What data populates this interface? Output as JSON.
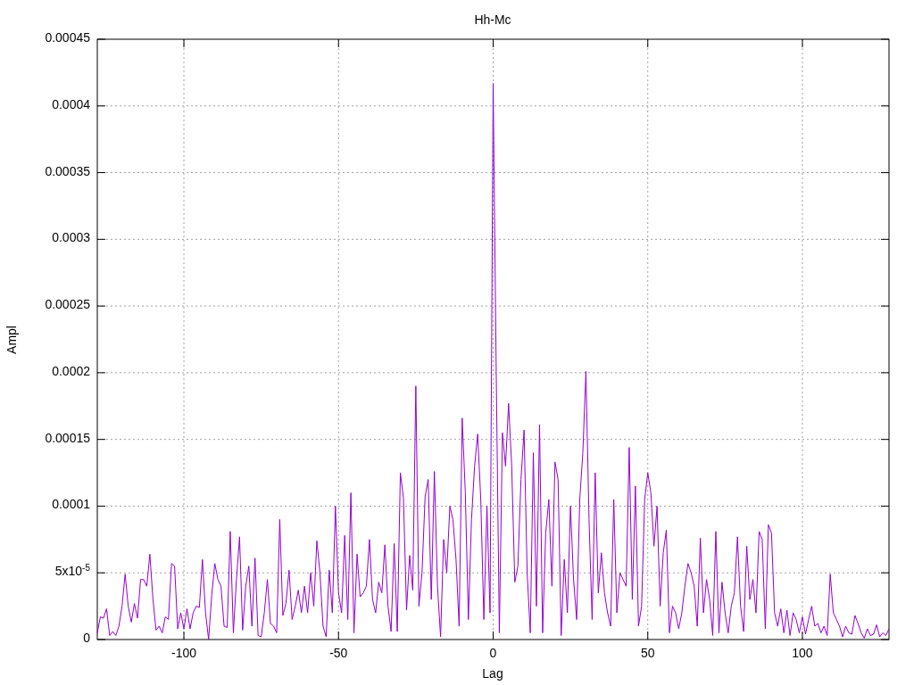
{
  "chart_data": {
    "type": "line",
    "grid": true,
    "title": "Hh-Mc",
    "xlabel": "Lag",
    "ylabel": "Ampl",
    "xlim": [
      -128,
      128
    ],
    "ylim": [
      0,
      0.00045
    ],
    "xticks": [
      -100,
      -50,
      0,
      50,
      100
    ],
    "yticks": [
      0,
      {
        "value": 5e-05,
        "label": "5x10$^{-5}$"
      },
      0.0001,
      0.00015,
      0.0002,
      0.00025,
      0.0003,
      0.00035,
      0.0004,
      0.00045
    ],
    "x": [
      -128,
      -127,
      -126,
      -125,
      -124,
      -123,
      -122,
      -121,
      -120,
      -119,
      -118,
      -117,
      -116,
      -115,
      -114,
      -113,
      -112,
      -111,
      -110,
      -109,
      -108,
      -107,
      -106,
      -105,
      -104,
      -103,
      -102,
      -101,
      -100,
      -99,
      -98,
      -97,
      -96,
      -95,
      -94,
      -93,
      -92,
      -91,
      -90,
      -89,
      -88,
      -87,
      -86,
      -85,
      -84,
      -83,
      -82,
      -81,
      -80,
      -79,
      -78,
      -77,
      -76,
      -75,
      -74,
      -73,
      -72,
      -71,
      -70,
      -69,
      -68,
      -67,
      -66,
      -65,
      -64,
      -63,
      -62,
      -61,
      -60,
      -59,
      -58,
      -57,
      -56,
      -55,
      -54,
      -53,
      -52,
      -51,
      -50,
      -49,
      -48,
      -47,
      -46,
      -45,
      -44,
      -43,
      -42,
      -41,
      -40,
      -39,
      -38,
      -37,
      -36,
      -35,
      -34,
      -33,
      -32,
      -31,
      -30,
      -29,
      -28,
      -27,
      -26,
      -25,
      -24,
      -23,
      -22,
      -21,
      -20,
      -19,
      -18,
      -17,
      -16,
      -15,
      -14,
      -13,
      -12,
      -11,
      -10,
      -9,
      -8,
      -7,
      -6,
      -5,
      -4,
      -3,
      -2,
      -1,
      0,
      1,
      2,
      3,
      4,
      5,
      6,
      7,
      8,
      9,
      10,
      11,
      12,
      13,
      14,
      15,
      16,
      17,
      18,
      19,
      20,
      21,
      22,
      23,
      24,
      25,
      26,
      27,
      28,
      29,
      30,
      31,
      32,
      33,
      34,
      35,
      36,
      37,
      38,
      39,
      40,
      41,
      42,
      43,
      44,
      45,
      46,
      47,
      48,
      49,
      50,
      51,
      52,
      53,
      54,
      55,
      56,
      57,
      58,
      59,
      60,
      61,
      62,
      63,
      64,
      65,
      66,
      67,
      68,
      69,
      70,
      71,
      72,
      73,
      74,
      75,
      76,
      77,
      78,
      79,
      80,
      81,
      82,
      83,
      84,
      85,
      86,
      87,
      88,
      89,
      90,
      91,
      92,
      93,
      94,
      95,
      96,
      97,
      98,
      99,
      100,
      101,
      102,
      103,
      104,
      105,
      106,
      107,
      108,
      109,
      110,
      111,
      112,
      113,
      114,
      115,
      116,
      117,
      118,
      119,
      120,
      121,
      122,
      123,
      124,
      125,
      126,
      127,
      128
    ],
    "series": [
      {
        "color": "#9400d3",
        "values": [
          5e-06,
          1.7e-05,
          1.6e-05,
          2.3e-05,
          3e-06,
          6e-06,
          3e-06,
          1e-05,
          2.5e-05,
          4.9e-05,
          2.5e-05,
          1.3e-05,
          2.7e-05,
          1.6e-05,
          4.5e-05,
          4.5e-05,
          4e-05,
          6.4e-05,
          3e-05,
          7e-06,
          1e-05,
          5e-06,
          1.7e-05,
          1.5e-05,
          5.7e-05,
          5.5e-05,
          8e-06,
          2e-05,
          8e-06,
          2.3e-05,
          8e-06,
          2e-05,
          2.5e-05,
          2.4e-05,
          6e-05,
          2e-05,
          0,
          3.3e-05,
          5.7e-05,
          4.5e-05,
          4e-05,
          1e-05,
          9e-06,
          8.1e-05,
          5e-06,
          4.5e-05,
          7.7e-05,
          7e-06,
          4e-05,
          5.5e-05,
          1e-05,
          6.1e-05,
          3e-06,
          2e-06,
          2e-05,
          4.5e-05,
          1.2e-05,
          1e-05,
          5e-06,
          9e-05,
          1.8e-05,
          2.7e-05,
          5.2e-05,
          1.5e-05,
          2.5e-05,
          3.7e-05,
          2e-05,
          4e-05,
          2e-05,
          5e-05,
          2.5e-05,
          7.4e-05,
          5e-05,
          1e-05,
          2e-06,
          5.2e-05,
          2e-05,
          0.0001,
          3.5e-05,
          2e-05,
          7.8e-05,
          1.5e-05,
          0.00011,
          5e-06,
          6.4e-05,
          3.2e-05,
          3.5e-05,
          4e-05,
          7.5e-05,
          3e-05,
          2e-05,
          4.3e-05,
          3.5e-05,
          7.1e-05,
          2.5e-05,
          6e-06,
          7.2e-05,
          6e-06,
          0.000125,
          0.000106,
          2.2e-05,
          6.3e-05,
          3.7e-05,
          0.00019,
          2.5e-05,
          5e-05,
          0.000107,
          0.00012,
          3e-05,
          0.000126,
          4e-05,
          2e-06,
          7.5e-05,
          5e-05,
          0.0001,
          9e-05,
          6e-05,
          1e-05,
          0.000166,
          0.00011,
          1.5e-05,
          9e-05,
          0.00013,
          0.000154,
          0.000105,
          1.5e-05,
          0.0001,
          2e-05,
          0.000417,
          0.0002,
          5e-06,
          0.000155,
          0.00013,
          0.000177,
          0.00013,
          4.3e-05,
          5.5e-05,
          0.00012,
          0.000157,
          5e-05,
          5e-06,
          0.00014,
          2.5e-05,
          0.000161,
          5e-06,
          8e-05,
          0.000105,
          4e-05,
          0.000133,
          0.00012,
          3e-06,
          6e-05,
          2e-05,
          0.0001,
          4.5e-05,
          1.5e-05,
          0.000105,
          0.00014,
          0.000201,
          9e-05,
          1.5e-05,
          0.000125,
          3.5e-05,
          6.5e-05,
          3.5e-05,
          2e-05,
          1e-05,
          0.000105,
          2e-05,
          5e-05,
          4.5e-05,
          4e-05,
          0.000144,
          3e-05,
          0.000115,
          1e-05,
          2.5e-05,
          0.000105,
          0.000125,
          0.00011,
          7e-05,
          0.0001,
          2.5e-05,
          6.5e-05,
          8.2e-05,
          5e-06,
          2.5e-05,
          2e-05,
          8e-06,
          2e-05,
          4e-05,
          5.7e-05,
          5e-05,
          4e-05,
          1e-05,
          7.6e-05,
          2e-05,
          4.5e-05,
          3e-05,
          3e-06,
          8.1e-05,
          5e-06,
          4.3e-05,
          2e-05,
          5e-06,
          2.5e-05,
          3.5e-05,
          7.7e-05,
          2.5e-05,
          6e-06,
          7e-05,
          3e-05,
          4.5e-05,
          2e-05,
          8.1e-05,
          7.5e-05,
          8e-06,
          8.6e-05,
          8e-05,
          2e-05,
          1e-05,
          2.3e-05,
          5e-06,
          2.2e-05,
          3e-06,
          2e-05,
          1.5e-05,
          5e-06,
          1.7e-05,
          4e-06,
          1.5e-05,
          2.5e-05,
          1e-05,
          1.2e-05,
          5e-06,
          1e-05,
          3e-06,
          4.9e-05,
          2e-05,
          1.5e-05,
          1e-05,
          2e-06,
          1e-05,
          5e-06,
          4e-06,
          1.8e-05,
          1.2e-05,
          5e-06,
          1e-06,
          8e-06,
          3e-06,
          4e-06,
          1.1e-05,
          2e-06,
          5e-06,
          3e-06,
          8e-06
        ]
      }
    ]
  }
}
